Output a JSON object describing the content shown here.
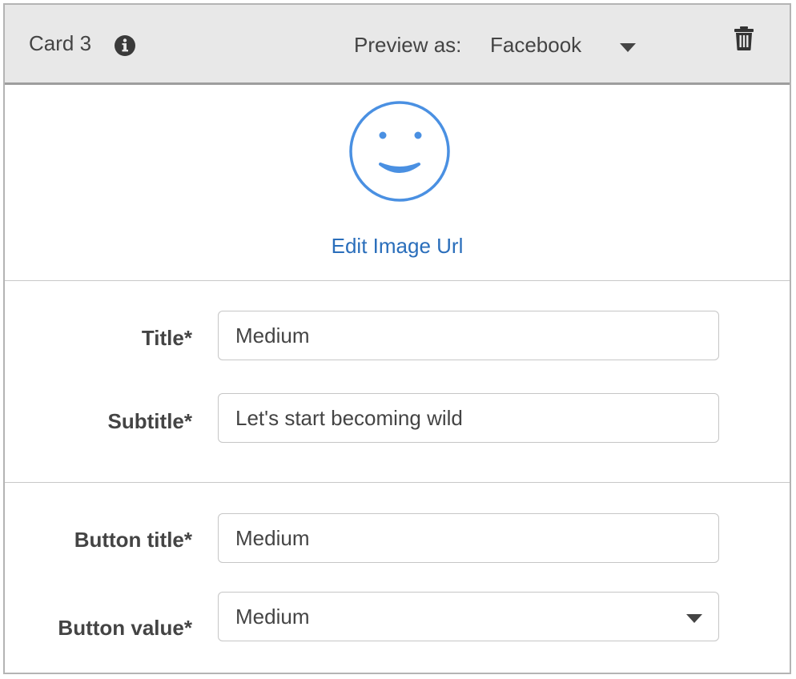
{
  "header": {
    "card_title": "Card 3",
    "preview_label": "Preview as:",
    "preview_value": "Facebook"
  },
  "image": {
    "edit_link": "Edit Image Url"
  },
  "fields": {
    "title_label": "Title*",
    "title_value": "Medium",
    "subtitle_label": "Subtitle*",
    "subtitle_value": "Let's start becoming wild"
  },
  "buttons": {
    "button_title_label": "Button title*",
    "button_title_value": "Medium",
    "button_value_label": "Button value*",
    "button_value_value": "Medium"
  },
  "colors": {
    "link": "#2a6ebb",
    "smiley": "#4a90e2",
    "header_bg": "#e8e8e8"
  }
}
